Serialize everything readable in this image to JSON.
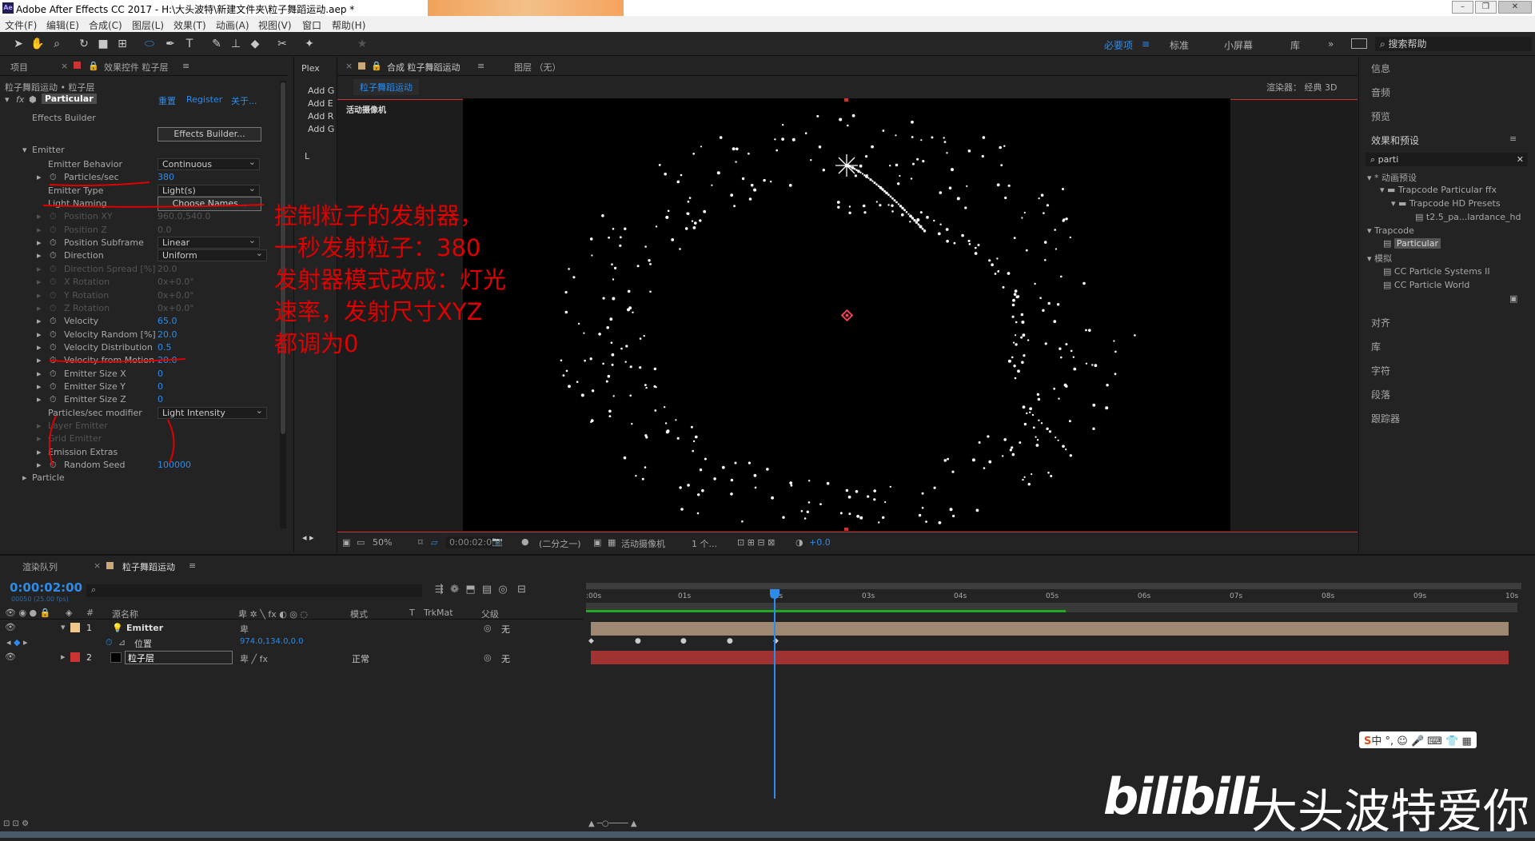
{
  "window": {
    "title": "Adobe After Effects CC 2017 - H:\\大头波特\\新建文件夹\\粒子舞蹈运动.aep *",
    "icon": "Ae"
  },
  "menu": [
    "文件(F)",
    "编辑(E)",
    "合成(C)",
    "图层(L)",
    "效果(T)",
    "动画(A)",
    "视图(V)",
    "窗口",
    "帮助(H)"
  ],
  "workspaces": {
    "active": "必要项",
    "items": [
      "标准",
      "小屏幕",
      "库"
    ],
    "search": "搜索帮助"
  },
  "left_panel": {
    "tab_project": "项目",
    "tab_effects": "效果控件 粒子层",
    "path": "粒子舞蹈运动 • 粒子层",
    "effect_name": "Particular",
    "reset": "重置",
    "register": "Register",
    "about": "关于...",
    "effects_builder": "Effects Builder",
    "effects_builder_btn": "Effects Builder...",
    "emitter_group": "Emitter",
    "props": [
      {
        "label": "Emitter Behavior",
        "value": "Continuous",
        "kind": "dd"
      },
      {
        "label": "Particles/sec",
        "value": "380",
        "kind": "val"
      },
      {
        "label": "Emitter Type",
        "value": "Light(s)",
        "kind": "dd"
      },
      {
        "label": "Light Naming",
        "value": "Choose Names...",
        "kind": "btn"
      },
      {
        "label": "Position XY",
        "value": "960.0,540.0",
        "kind": "dim"
      },
      {
        "label": "Position Z",
        "value": "0.0",
        "kind": "dim"
      },
      {
        "label": "Position Subframe",
        "value": "Linear",
        "kind": "dd"
      },
      {
        "label": "Direction",
        "value": "Uniform",
        "kind": "dd"
      },
      {
        "label": "Direction Spread [%]",
        "value": "20.0",
        "kind": "dim"
      },
      {
        "label": "X Rotation",
        "value": "0x+0.0°",
        "kind": "dim"
      },
      {
        "label": "Y Rotation",
        "value": "0x+0.0°",
        "kind": "dim"
      },
      {
        "label": "Z Rotation",
        "value": "0x+0.0°",
        "kind": "dim"
      },
      {
        "label": "Velocity",
        "value": "65.0",
        "kind": "val"
      },
      {
        "label": "Velocity Random [%]",
        "value": "20.0",
        "kind": "val"
      },
      {
        "label": "Velocity Distribution",
        "value": "0.5",
        "kind": "val"
      },
      {
        "label": "Velocity from Motion",
        "value": "20.0",
        "kind": "val"
      },
      {
        "label": "Emitter Size X",
        "value": "0",
        "kind": "val"
      },
      {
        "label": "Emitter Size Y",
        "value": "0",
        "kind": "val"
      },
      {
        "label": "Emitter Size Z",
        "value": "0",
        "kind": "val"
      },
      {
        "label": "Particles/sec modifier",
        "value": "Light Intensity",
        "kind": "dd"
      },
      {
        "label": "Layer Emitter",
        "value": "",
        "kind": "dim"
      },
      {
        "label": "Grid Emitter",
        "value": "",
        "kind": "dim"
      },
      {
        "label": "Emission Extras",
        "value": "",
        "kind": "plain"
      },
      {
        "label": "Random Seed",
        "value": "100000",
        "kind": "val"
      },
      {
        "label": "Particle",
        "value": "",
        "kind": "plain"
      }
    ]
  },
  "plex": {
    "title": "Plex",
    "items": [
      "Add G",
      "Add E",
      "Add R",
      "Add G"
    ],
    "l": "L"
  },
  "comp": {
    "tab": "合成 粒子舞蹈运动",
    "layer_tab": "图层 （无）",
    "sub_tab": "粒子舞蹈运动",
    "renderer_label": "渲染器：",
    "renderer": "经典 3D",
    "camera_label": "活动摄像机",
    "zoom": "50%",
    "time": "0:00:02:00",
    "resolution": "(二分之一)",
    "camera": "活动摄像机",
    "views": "1 个...",
    "exposure": "+0.0"
  },
  "annotation": [
    "控制粒子的发射器，",
    "一秒发射粒子：380",
    "发射器模式改成：灯光",
    "速率，发射尺寸XYZ",
    "都调为0"
  ],
  "right_panel": {
    "items": [
      "信息",
      "音频",
      "预览",
      "效果和预设"
    ],
    "search": "parti",
    "tree": [
      "* 动画预设",
      "Trapcode Particular ffx",
      "Trapcode HD Presets",
      "t2.5_pa...lardance_hd",
      "Trapcode",
      "Particular",
      "模拟",
      "CC Particle Systems II",
      "CC Particle World"
    ],
    "bottom": [
      "对齐",
      "库",
      "字符",
      "段落",
      "跟踪器"
    ]
  },
  "timeline": {
    "tab_render": "渲染队列",
    "tab_comp": "粒子舞蹈运动",
    "timecode": "0:00:02:00",
    "fps": "00050 (25.00 fps)",
    "col_source": "源名称",
    "col_mode": "模式",
    "col_t": "T",
    "col_trkmat": "TrkMat",
    "col_parent": "父级",
    "layers": [
      {
        "num": "1",
        "name": "Emitter",
        "parent": "无"
      },
      {
        "num": "2",
        "name": "粒子层",
        "mode": "正常",
        "parent": "无"
      }
    ],
    "position_label": "位置",
    "position_value": "974.0,134.0,0.0",
    "ruler": [
      ":00s",
      "01s",
      "02s",
      "03s",
      "04s",
      "05s",
      "06s",
      "07s",
      "08s",
      "09s",
      "10s"
    ]
  },
  "watermark": {
    "logo": "bilibili",
    "text": "大头波特爱你"
  },
  "ime": "中"
}
